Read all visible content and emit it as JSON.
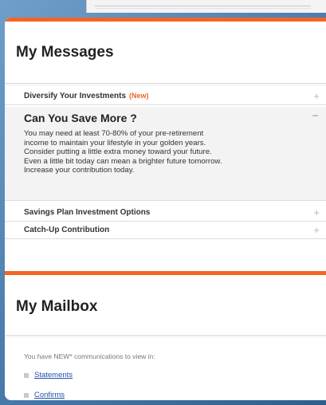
{
  "messages": {
    "title": "My Messages",
    "items": [
      {
        "label": "Diversify Your Investments",
        "badge": "(New)",
        "toggle": "+"
      },
      {
        "label": "Savings Plan Investment Options",
        "toggle": "+"
      },
      {
        "label": "Catch-Up Contribution",
        "toggle": "+"
      }
    ],
    "expanded": {
      "heading": "Can You Save More ?",
      "toggle": "−",
      "lines": [
        "You may need at least 70-80% of your pre-retirement",
        "income to maintain your lifestyle in your golden years.",
        "Consider putting a little extra money toward your future.",
        "Even a little bit today can mean a brighter future tomorrow.",
        "Increase your contribution today."
      ]
    }
  },
  "mailbox": {
    "title": "My Mailbox",
    "intro": "You have NEW* communications to view in:",
    "links": [
      "Statements",
      "Confirms"
    ]
  },
  "colors": {
    "accent": "#f26522",
    "link": "#1f4fb0",
    "background": "#4d7fae"
  }
}
